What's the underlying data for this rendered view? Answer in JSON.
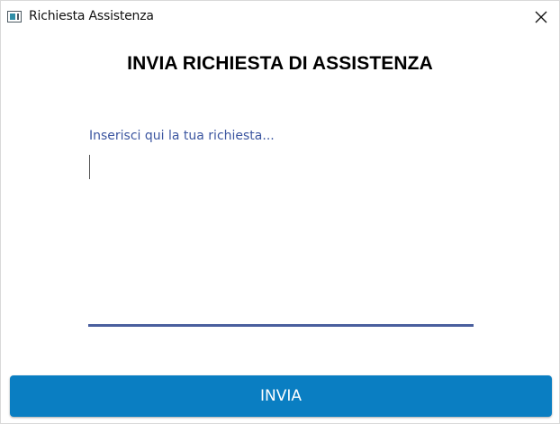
{
  "window": {
    "title": "Richiesta Assistenza"
  },
  "icons": {
    "app": "app-window-icon",
    "close": "close-icon"
  },
  "page": {
    "heading": "INVIA RICHIESTA DI ASSISTENZA"
  },
  "request": {
    "placeholder": "Inserisci qui la tua richiesta...",
    "value": ""
  },
  "actions": {
    "submit_label": "INVIA"
  },
  "colors": {
    "accent": "#0a7ec2",
    "field_underline": "#4a5f9e",
    "placeholder_text": "#3c56a0"
  }
}
